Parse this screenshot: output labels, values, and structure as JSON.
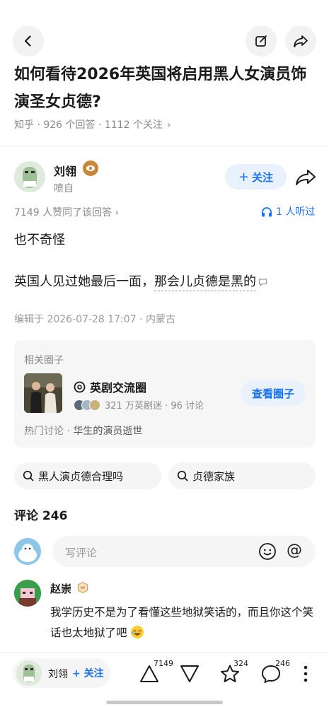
{
  "question": {
    "title": "如何看待2026年英国将启用黑人女演员饰演圣女贞德?",
    "meta": "知乎 · 926 个回答 · 1112 个关注",
    "meta_chevron": "›"
  },
  "author": {
    "name": "刘翎",
    "subtitle": "喷自",
    "follow_label": "关注",
    "follow_plus": "+"
  },
  "answer": {
    "votes_line": "7149 人赞同了该回答 ›",
    "listen_label": "1 人听过",
    "paragraph_1": "也不奇怪",
    "paragraph_2_plain": "英国人见过她最后一面，",
    "paragraph_2_dotted": "那会儿贞德是黑的",
    "edit_time": "编辑于 2026-07-28 17:07 · 内蒙古"
  },
  "circle": {
    "section_label": "相关圈子",
    "name": "英剧交流圈",
    "stats": "321 万英剧迷 · 96 讨论",
    "view_label": "查看圈子",
    "hot_prefix": "热门讨论 · ",
    "hot_topic": "华生的演员逝世"
  },
  "related_searches": [
    "黑人演贞德合理吗",
    "贞德家族"
  ],
  "comments": {
    "title": "评论 246",
    "input_placeholder": "写评论",
    "at_symbol": "@",
    "first": {
      "name": "赵崇",
      "text": "我学历史不是为了看懂这些地狱笑话的，而且你这个笑话也太地狱了吧"
    }
  },
  "bottom_bar": {
    "author_name": "刘翎",
    "follow_label": "+ 关注",
    "upvotes": "7149",
    "favorites": "324",
    "comment_count": "246"
  },
  "colors": {
    "accent": "#1772f6",
    "accent_bg": "#e9f1fd",
    "muted_text": "#8a8a8a",
    "card_bg": "#f6f6f6"
  },
  "icons": [
    "back-arrow-icon",
    "edit-icon",
    "share-icon",
    "eye-badge-icon",
    "headphone-icon",
    "comment-bubble-icon",
    "circle-logo-icon",
    "search-icon",
    "emoji-icon",
    "upvote-icon",
    "downvote-icon",
    "star-icon",
    "comment-icon",
    "more-icon"
  ]
}
